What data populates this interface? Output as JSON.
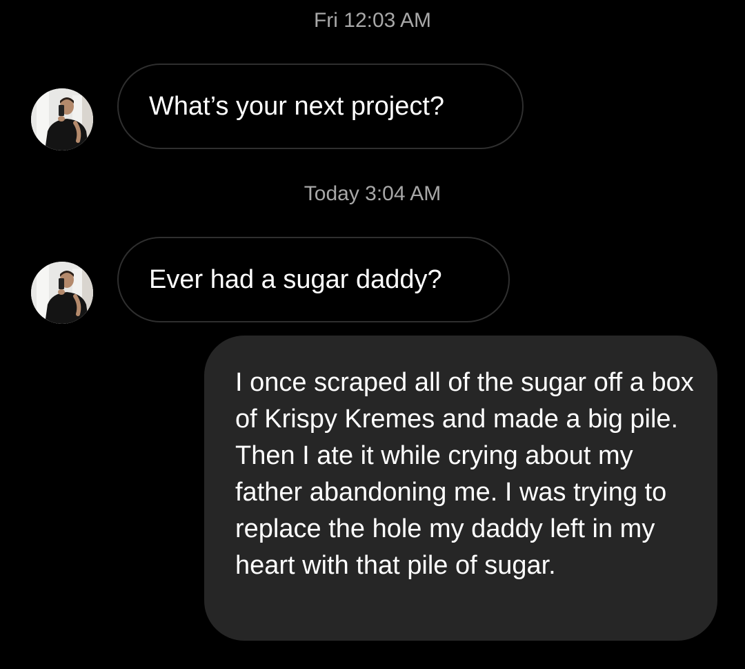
{
  "conversation": {
    "messages": [
      {
        "timestamp": "Fri 12:03 AM",
        "sender": "other",
        "text": "What’s your next project?"
      },
      {
        "timestamp": "Today 3:04 AM",
        "sender": "other",
        "text": "Ever had a sugar daddy?"
      },
      {
        "sender": "me",
        "text": "I once scraped all of the sugar off a box of Krispy Kremes and made a big pile. Then I ate it while crying about my father abandoning me. I was trying to replace the hole my daddy left in my heart with that pile of sugar."
      }
    ]
  },
  "colors": {
    "background": "#000000",
    "incoming_bubble_border": "#2f2f2f",
    "outgoing_bubble": "#262626",
    "timestamp_text": "#a8a8a8",
    "message_text": "#ffffff"
  },
  "icons": {
    "avatar": "profile-photo-avatar"
  }
}
